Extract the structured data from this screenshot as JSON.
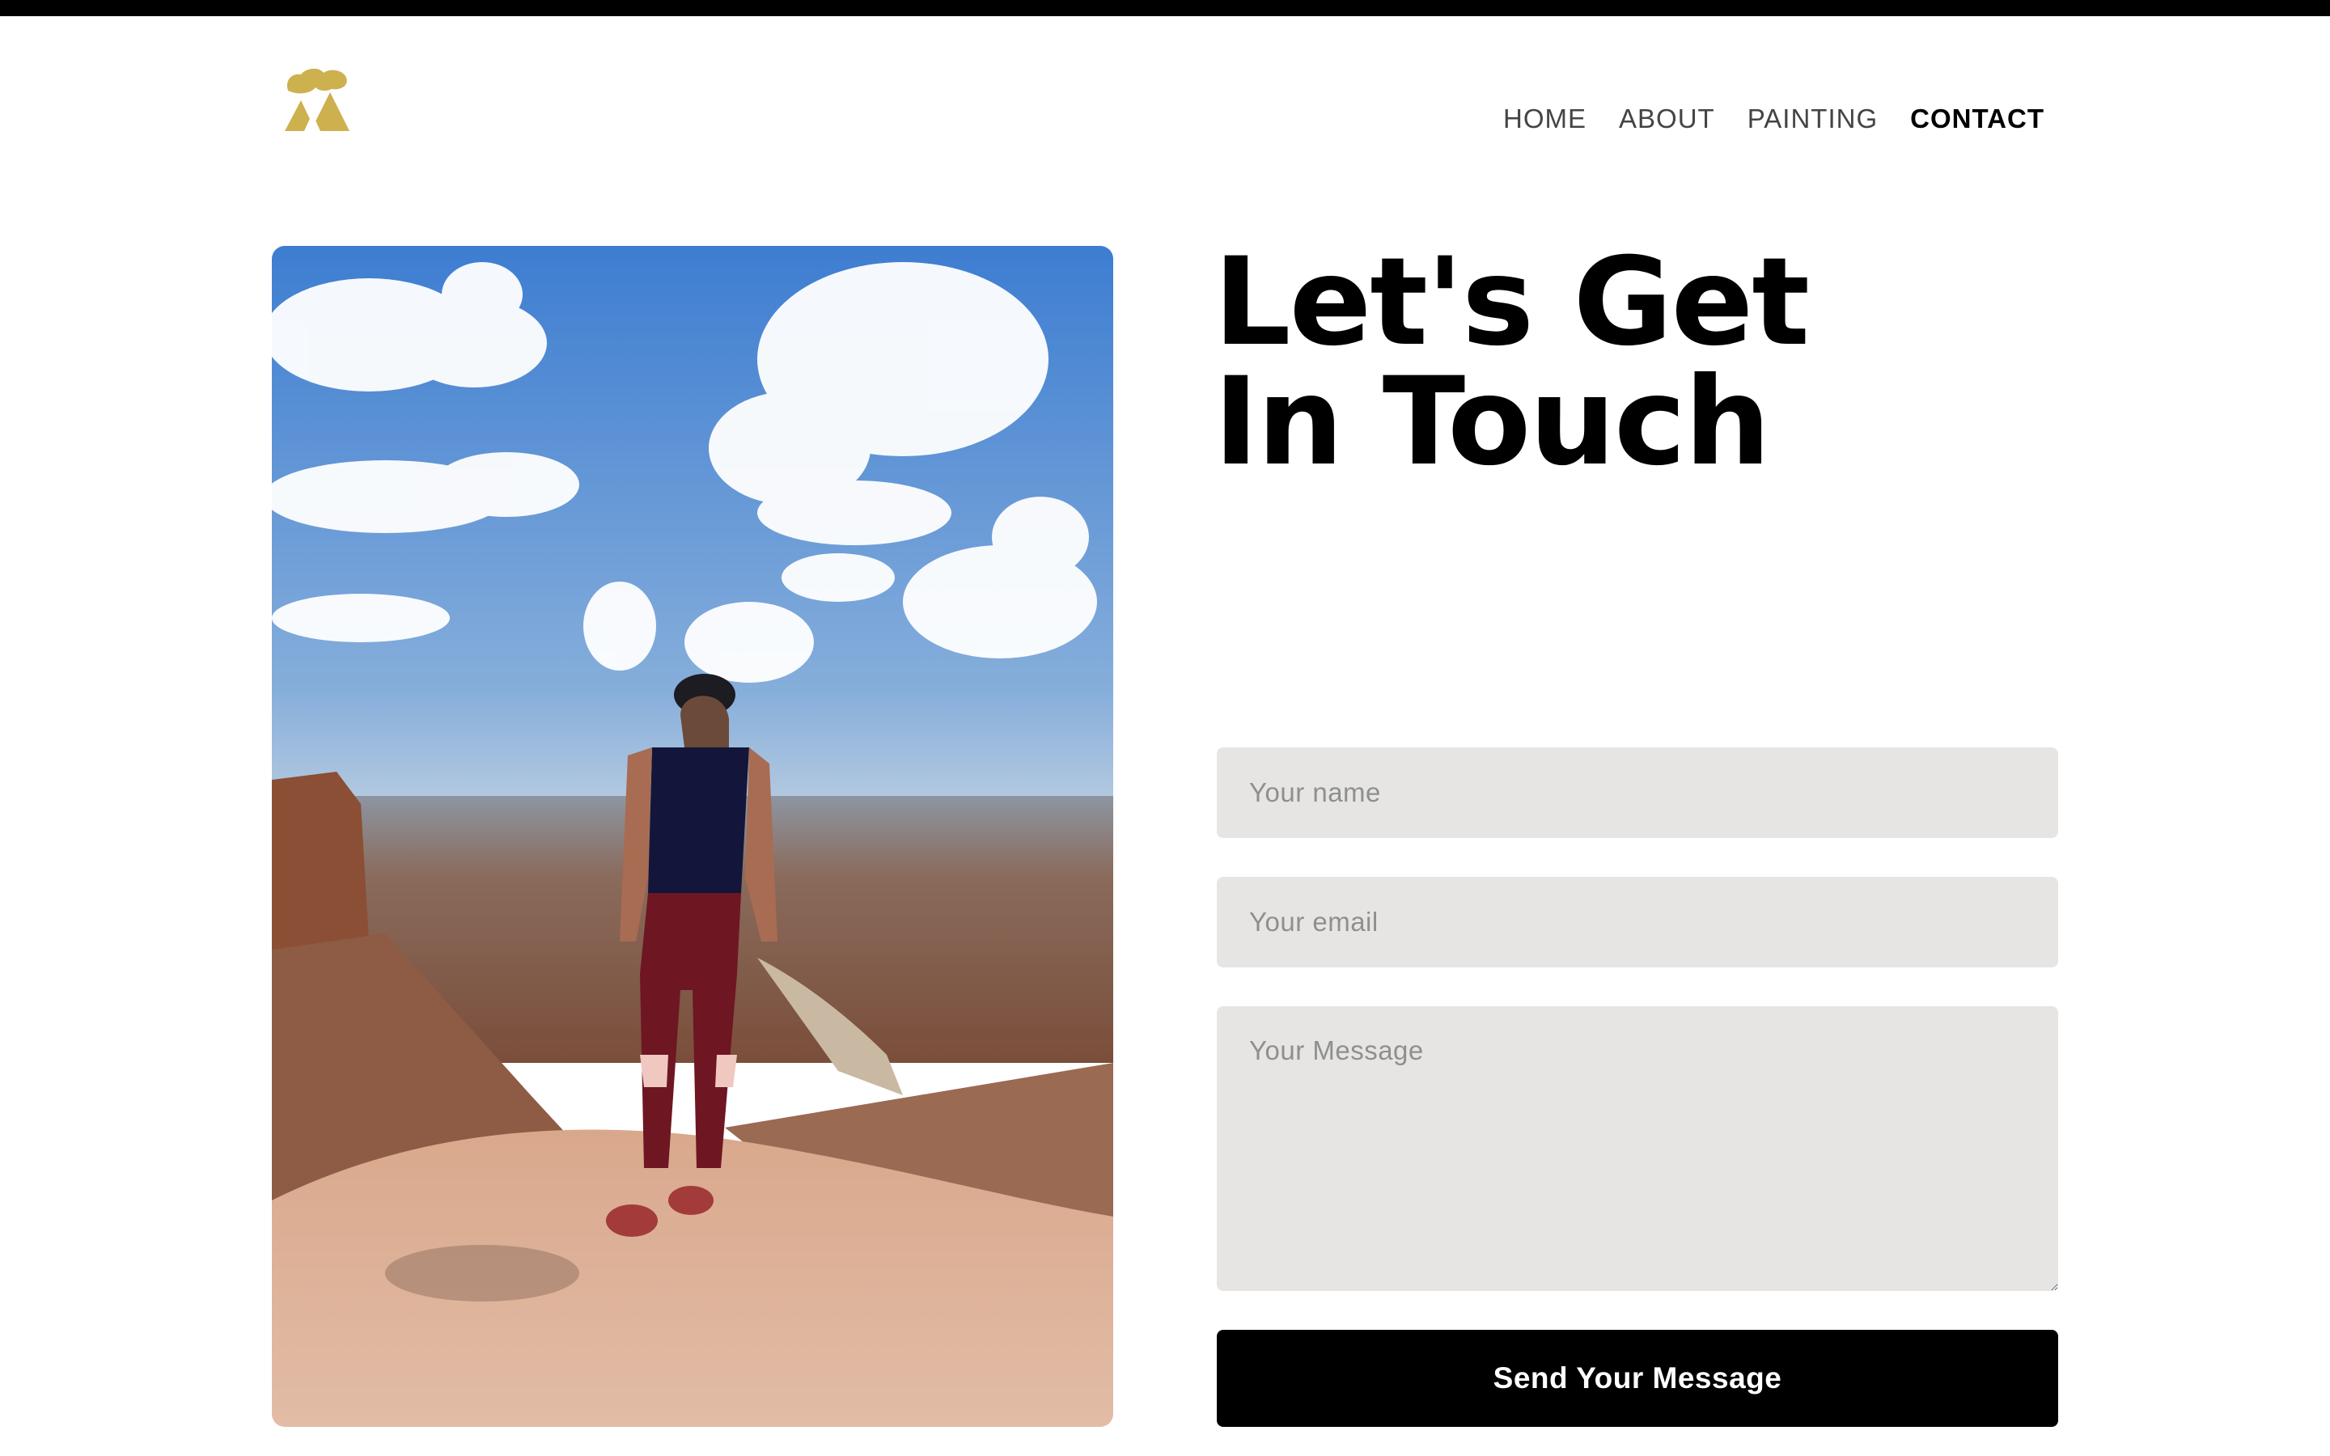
{
  "brand": {
    "logo_icon": "stylized-mountain-logo-icon",
    "logo_color": "#cdb14e"
  },
  "nav": {
    "items": [
      {
        "label": "HOME"
      },
      {
        "label": "ABOUT"
      },
      {
        "label": "PAINTING"
      },
      {
        "label": "CONTACT"
      }
    ],
    "active": "CONTACT"
  },
  "main": {
    "heading_line1": "Let's Get",
    "heading_line2": "In Touch",
    "photo_icon": "hiker-canyon-photo"
  },
  "form": {
    "name_placeholder": "Your name",
    "email_placeholder": "Your email",
    "message_placeholder": "Your Message",
    "name_value": "",
    "email_value": "",
    "message_value": "",
    "submit_label": "Send Your Message"
  },
  "colors": {
    "accent": "#cdb14e",
    "field_bg": "#e6e5e4",
    "button_bg": "#000000",
    "top_bar": "#000000"
  }
}
